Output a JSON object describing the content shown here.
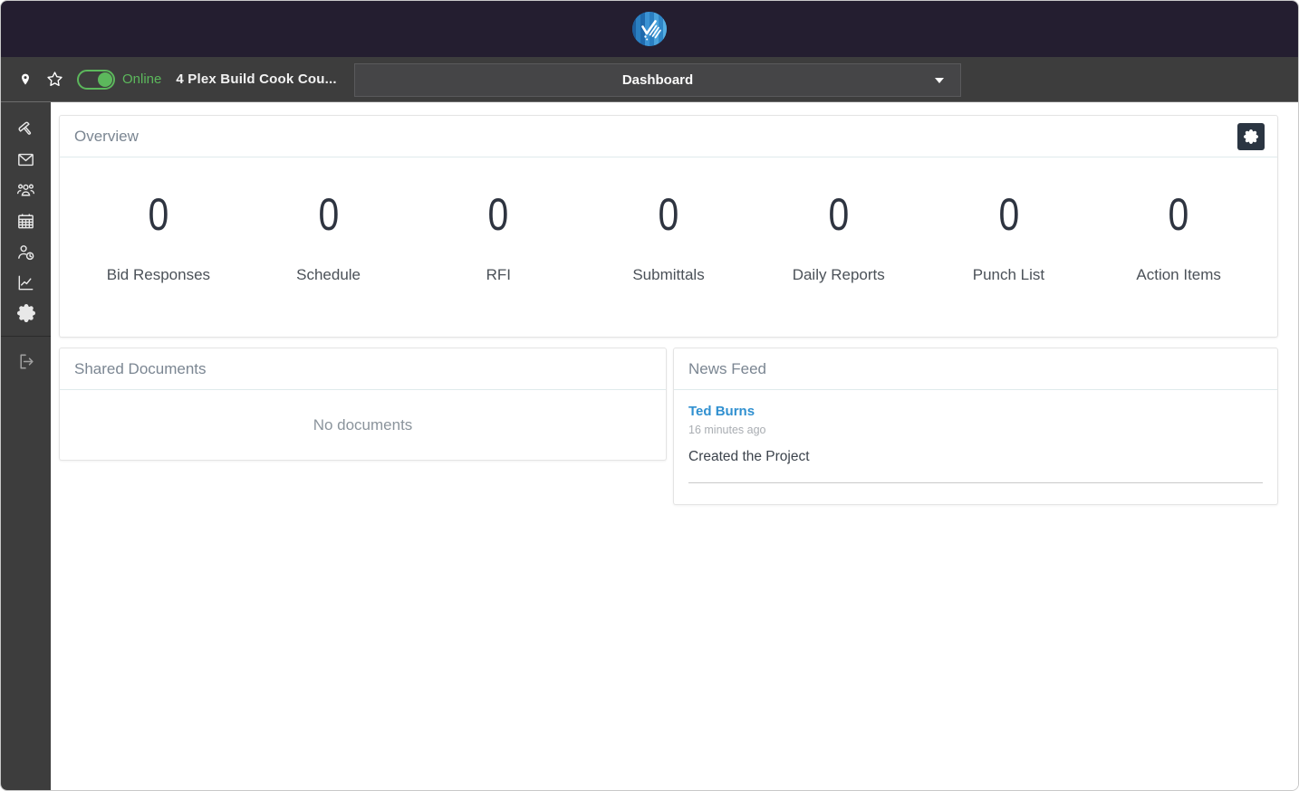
{
  "project_bar": {
    "online_label": "Online",
    "project_name": "4 Plex Build Cook Cou...",
    "view_selector": "Dashboard"
  },
  "sidebar": {
    "items": [
      {
        "id": "projects",
        "icon": "hammer-icon"
      },
      {
        "id": "messages",
        "icon": "envelope-icon"
      },
      {
        "id": "contacts",
        "icon": "people-icon"
      },
      {
        "id": "calendar",
        "icon": "calendar-icon"
      },
      {
        "id": "time",
        "icon": "person-clock-icon"
      },
      {
        "id": "reports",
        "icon": "chart-icon"
      },
      {
        "id": "settings",
        "icon": "gear-icon"
      },
      {
        "id": "logout",
        "icon": "logout-icon"
      }
    ]
  },
  "overview": {
    "title": "Overview",
    "counters": [
      {
        "label": "Bid Responses",
        "value": "0"
      },
      {
        "label": "Schedule",
        "value": "0"
      },
      {
        "label": "RFI",
        "value": "0"
      },
      {
        "label": "Submittals",
        "value": "0"
      },
      {
        "label": "Daily Reports",
        "value": "0"
      },
      {
        "label": "Punch List",
        "value": "0"
      },
      {
        "label": "Action Items",
        "value": "0"
      }
    ]
  },
  "shared_documents": {
    "title": "Shared Documents",
    "empty_message": "No documents"
  },
  "news_feed": {
    "title": "News Feed",
    "items": [
      {
        "author": "Ted Burns",
        "time": "16 minutes ago",
        "text": "Created the Project"
      }
    ]
  },
  "colors": {
    "topbar_bg": "#241e30",
    "bar_bg": "#3d3d3d",
    "online_green": "#5cb85c",
    "link_blue": "#3090d0",
    "gear_button_bg": "#2b3542",
    "logo_blue": "#2a7fc1"
  }
}
